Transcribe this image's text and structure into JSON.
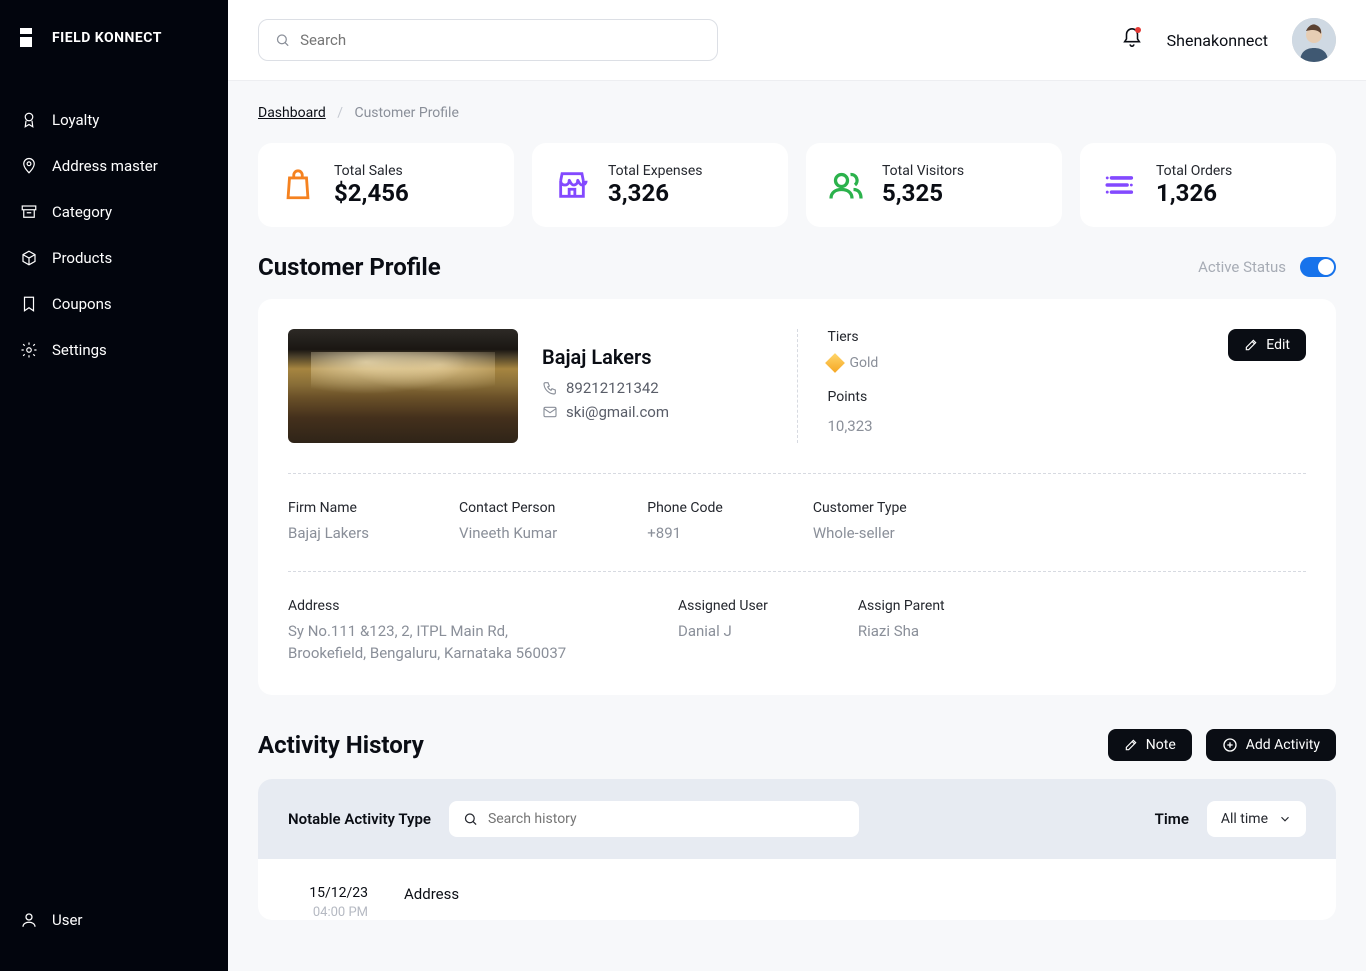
{
  "brand": "FIELD KONNECT",
  "nav": [
    {
      "label": "Loyalty"
    },
    {
      "label": "Address master"
    },
    {
      "label": "Category"
    },
    {
      "label": "Products"
    },
    {
      "label": "Coupons"
    },
    {
      "label": "Settings"
    }
  ],
  "user_label": "User",
  "search_placeholder": "Search",
  "top_user": "Shenakonnect",
  "breadcrumb": {
    "root": "Dashboard",
    "current": "Customer Profile"
  },
  "stats": [
    {
      "label": "Total Sales",
      "value": "$2,456",
      "icon": "bag",
      "color": "#f58220"
    },
    {
      "label": "Total Expenses",
      "value": "3,326",
      "icon": "store",
      "color": "#8349ff"
    },
    {
      "label": "Total Visitors",
      "value": "5,325",
      "icon": "group",
      "color": "#2bb24c"
    },
    {
      "label": "Total Orders",
      "value": "1,326",
      "icon": "trend",
      "color": "#8349ff"
    }
  ],
  "section": {
    "title": "Customer Profile",
    "active_status": "Active Status"
  },
  "profile": {
    "name": "Bajaj Lakers",
    "phone": "89212121342",
    "email": "ski@gmail.com",
    "tiers_label": "Tiers",
    "tier": "Gold",
    "points_label": "Points",
    "points": "10,323",
    "edit": "Edit"
  },
  "fields": {
    "firm_name": {
      "label": "Firm Name",
      "value": "Bajaj Lakers"
    },
    "contact_person": {
      "label": "Contact Person",
      "value": "Vineeth Kumar"
    },
    "phone_code": {
      "label": "Phone Code",
      "value": "+891"
    },
    "customer_type": {
      "label": "Customer Type",
      "value": "Whole-seller"
    },
    "address": {
      "label": "Address",
      "value": "Sy No.111 &123, 2, ITPL Main Rd, Brookefield, Bengaluru, Karnataka 560037"
    },
    "assigned_user": {
      "label": "Assigned User",
      "value": "Danial J"
    },
    "assign_parent": {
      "label": "Assign Parent",
      "value": "Riazi Sha"
    }
  },
  "history": {
    "title": "Activity History",
    "note_btn": "Note",
    "add_btn": "Add Activity",
    "notable_label": "Notable Activity Type",
    "search_placeholder": "Search history",
    "time_label": "Time",
    "time_value": "All time",
    "row": {
      "date": "15/12/23",
      "time": "04:00 PM",
      "title": "Address"
    }
  }
}
